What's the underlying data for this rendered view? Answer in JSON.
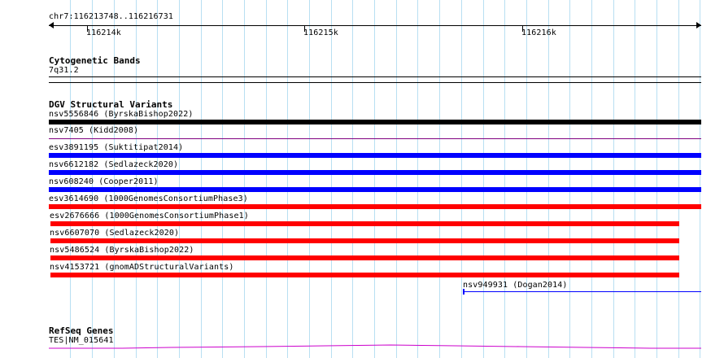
{
  "ruler": {
    "location": "chr7:116213748..116216731",
    "ticks": [
      "116214k",
      "116215k",
      "116216k"
    ]
  },
  "tracks": {
    "cytoband": {
      "title": "Cytogenetic Bands",
      "band": "7q31.2"
    },
    "dgv": {
      "title": "DGV Structural Variants",
      "variants": [
        {
          "label": "nsv5556846 (ByrskaBishop2022)",
          "color": "#000000"
        },
        {
          "label": "nsv7405 (Kidd2008)",
          "color": "#800080"
        },
        {
          "label": "esv3891195 (Suktitipat2014)",
          "color": "#0000ff"
        },
        {
          "label": "nsv6612182 (Sedlazeck2020)",
          "color": "#0000ff"
        },
        {
          "label": "nsv608240 (Cooper2011)",
          "color": "#0000ff"
        },
        {
          "label": "esv3614690 (1000GenomesConsortiumPhase3)",
          "color": "#ff0000"
        },
        {
          "label": "esv2676666 (1000GenomesConsortiumPhase1)",
          "color": "#ff0000"
        },
        {
          "label": "nsv6607070 (Sedlazeck2020)",
          "color": "#ff0000"
        },
        {
          "label": "nsv5486524 (ByrskaBishop2022)",
          "color": "#ff0000"
        },
        {
          "label": "nsv4153721 (gnomADStructuralVariants)",
          "color": "#ff0000"
        },
        {
          "label": "nsv949931 (Dogan2014)",
          "color": "#0000ff"
        }
      ]
    },
    "refseq": {
      "title": "RefSeq Genes",
      "gene_label": "TES|NM_015641",
      "color": "#cc00cc"
    }
  }
}
